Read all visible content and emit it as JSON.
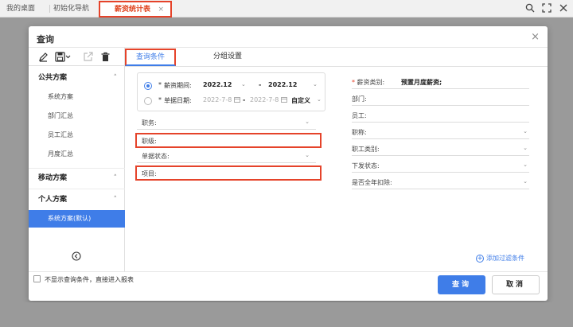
{
  "top_tabs": [
    {
      "label": "我的桌面"
    },
    {
      "label": "初始化导航"
    },
    {
      "label": "薪资统计表",
      "close": "×"
    }
  ],
  "top_icons": [
    "search-icon",
    "fullscreen-icon",
    "close-icon"
  ],
  "dialog": {
    "title": "查询",
    "close": "×"
  },
  "toolbar_icons": [
    "edit-icon",
    "save-icon",
    "export-icon",
    "delete-icon"
  ],
  "sidebar": {
    "groups": [
      {
        "label": "公共方案",
        "chevron": "˄",
        "items": [
          "系统方案",
          "部门汇总",
          "员工汇总",
          "月度汇总"
        ]
      },
      {
        "label": "移动方案",
        "chevron": "˄",
        "items": []
      },
      {
        "label": "个人方案",
        "chevron": "˄",
        "items": [
          "系统方案(默认)"
        ]
      }
    ]
  },
  "query_tabs": [
    "查询条件",
    "分组设置"
  ],
  "period": {
    "row1": {
      "required": "*",
      "label": "薪资期间:",
      "from": "2022.12",
      "dash": "-",
      "to": "2022.12"
    },
    "row2": {
      "required": "*",
      "label": "单据日期:",
      "from": "2022-7-8",
      "dash": "-",
      "to": "2022-7-8",
      "mode": "自定义"
    }
  },
  "left_fields": [
    {
      "label": "职务:"
    },
    {
      "label": "职级:"
    },
    {
      "label": "单据状态:"
    },
    {
      "label": "项目:"
    }
  ],
  "right_fields": [
    {
      "required": "*",
      "label": "薪资类别:",
      "value": "预置月度薪资;"
    },
    {
      "label": "部门:"
    },
    {
      "label": "员工:"
    },
    {
      "label": "职称:"
    },
    {
      "label": "职工类别:"
    },
    {
      "label": "下发状态:"
    },
    {
      "label": "是否全年扣除:"
    }
  ],
  "add_filter": {
    "plus": "+",
    "label": "添加过滤条件"
  },
  "footer": {
    "checkbox_label": "不显示查询条件，直接进入报表",
    "query_button": "查询",
    "cancel_button": "取消"
  },
  "colors": {
    "accent": "#3f7de8",
    "highlight": "#e5432a"
  }
}
